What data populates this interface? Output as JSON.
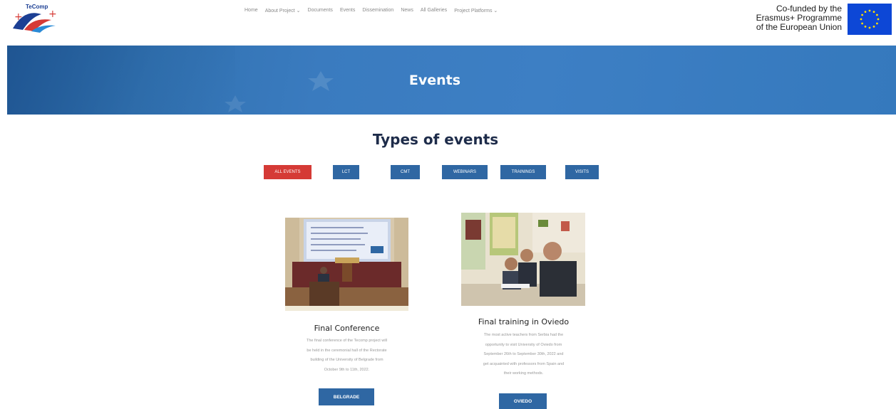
{
  "header": {
    "logo_text": "TeComp",
    "nav": [
      {
        "label": "Home"
      },
      {
        "label": "About Project ⌄"
      },
      {
        "label": "Documents"
      },
      {
        "label": "Events"
      },
      {
        "label": "Dissemination"
      },
      {
        "label": "News"
      },
      {
        "label": "All Galleries"
      },
      {
        "label": "Project Platforms ⌄"
      }
    ],
    "eu_lines": [
      "Co-funded by the",
      "Erasmus+ Programme",
      "of the European Union"
    ]
  },
  "banner": {
    "title": "Events"
  },
  "types": {
    "title": "Types of events",
    "filters": [
      {
        "label": "ALL EVENTS",
        "active": true
      },
      {
        "label": "LCT",
        "active": false
      },
      {
        "label": "CMT",
        "active": false
      },
      {
        "label": "WEBINARS",
        "active": false
      },
      {
        "label": "TRAININGS",
        "active": false
      },
      {
        "label": "VISITS",
        "active": false
      }
    ]
  },
  "events": [
    {
      "title": "Final Conference",
      "description": [
        "The final conference of the Tecomp project will",
        "be held in the ceremonial hall of the Rectorate",
        "building of the University of Belgrade from",
        "October 9th to 11th, 2022."
      ],
      "button": "BELGRADE"
    },
    {
      "title": "Final training in Oviedo",
      "description": [
        "The most active teachers from Serbia had the",
        "opportunity to visit University of Oviedo from",
        "September 26th to September 30th, 2022 and",
        "get acquainted with professors from Spain and",
        "their working methods."
      ],
      "button": "OVIEDO"
    }
  ],
  "colors": {
    "primary": "#2f67a3",
    "active_filter": "#d53a36",
    "banner": "#3a7bbf",
    "eu_flag": "#0d47d6",
    "eu_stars": "#ffdd00"
  }
}
